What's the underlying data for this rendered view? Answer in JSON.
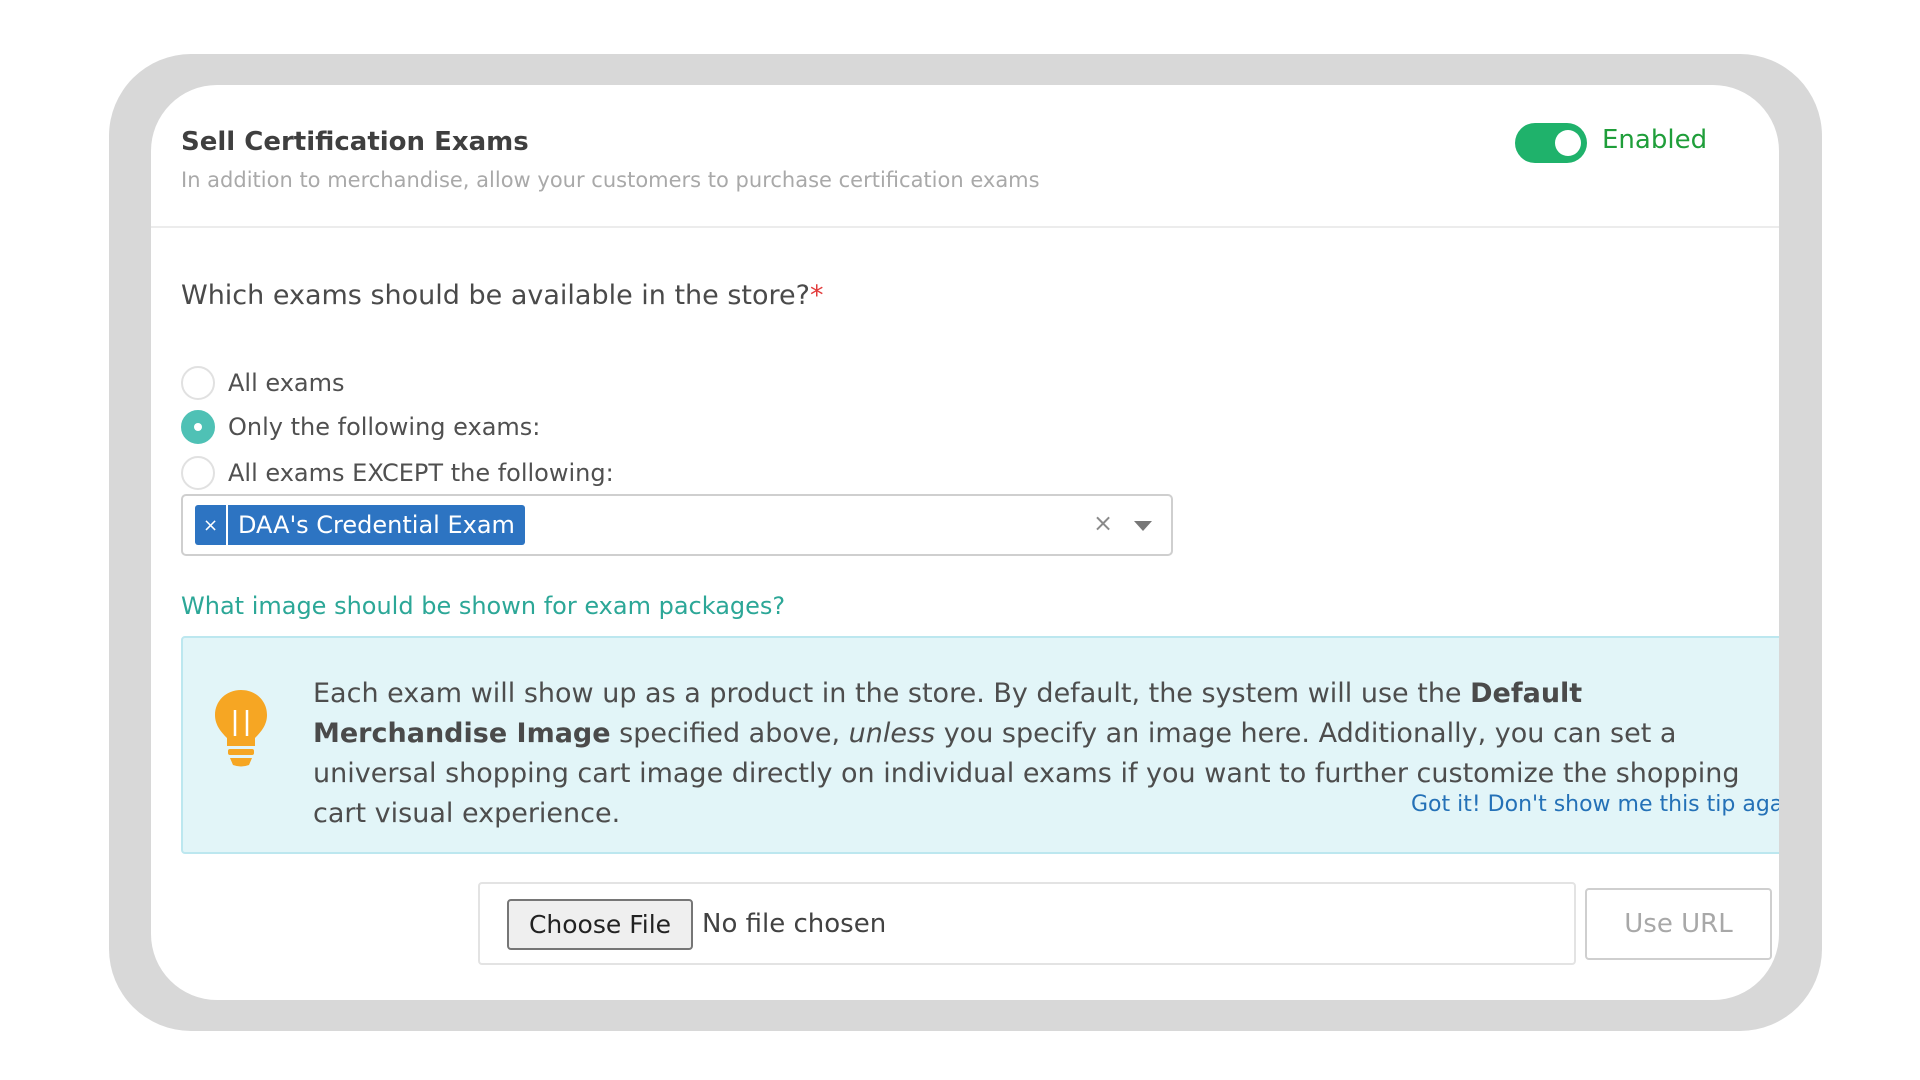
{
  "section": {
    "title": "Sell Certification Exams",
    "subtitle": "In addition to merchandise, allow your customers to purchase certification exams",
    "toggle_label": "Enabled",
    "toggle_on": true
  },
  "exam_availability": {
    "question": "Which exams should be available in the store?",
    "required_mark": "*",
    "options": [
      {
        "label": "All exams",
        "checked": false
      },
      {
        "label": "Only the following exams:",
        "checked": true
      },
      {
        "label": "All exams EXCEPT the following:",
        "checked": false
      }
    ],
    "selected_tags": [
      {
        "label": "DAA's Credential Exam",
        "remove": "×"
      }
    ],
    "clear_symbol": "×"
  },
  "image_section": {
    "question": "What image should be shown for exam packages?",
    "tip": {
      "text_1": "Each exam will show up as a product in the store. By default, the system will use the ",
      "bold_1": "Default Merchandise Image",
      "text_2": " specified above, ",
      "italic_1": "unless",
      "text_3": " you specify an image here. Additionally, you can set a universal shopping cart image directly on individual exams if you want to further customize the shopping cart visual experience.",
      "dismiss_link": "Got it! Don't show me this tip again"
    },
    "file_input": {
      "button_label": "Choose File",
      "status": "No file chosen"
    },
    "url_button": "Use URL"
  },
  "colors": {
    "accent_green": "#1fb26b",
    "radio_teal": "#4fc1b5",
    "tag_blue": "#2d74c2",
    "tip_background": "#e2f5f8",
    "bulb_orange": "#f6a623"
  }
}
